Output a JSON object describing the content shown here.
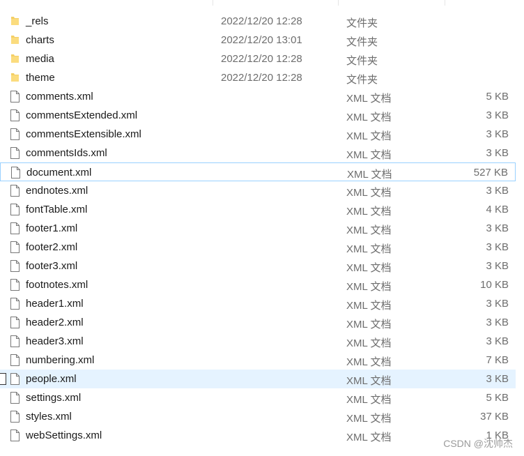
{
  "files": [
    {
      "name": "_rels",
      "date": "2022/12/20 12:28",
      "type": "文件夹",
      "size": "",
      "icon": "folder-icon"
    },
    {
      "name": "charts",
      "date": "2022/12/20 13:01",
      "type": "文件夹",
      "size": "",
      "icon": "folder-icon"
    },
    {
      "name": "media",
      "date": "2022/12/20 12:28",
      "type": "文件夹",
      "size": "",
      "icon": "folder-icon"
    },
    {
      "name": "theme",
      "date": "2022/12/20 12:28",
      "type": "文件夹",
      "size": "",
      "icon": "folder-icon"
    },
    {
      "name": "comments.xml",
      "date": "",
      "type": "XML 文档",
      "size": "5 KB",
      "icon": "file-icon"
    },
    {
      "name": "commentsExtended.xml",
      "date": "",
      "type": "XML 文档",
      "size": "3 KB",
      "icon": "file-icon"
    },
    {
      "name": "commentsExtensible.xml",
      "date": "",
      "type": "XML 文档",
      "size": "3 KB",
      "icon": "file-icon"
    },
    {
      "name": "commentsIds.xml",
      "date": "",
      "type": "XML 文档",
      "size": "3 KB",
      "icon": "file-icon"
    },
    {
      "name": "document.xml",
      "date": "",
      "type": "XML 文档",
      "size": "527 KB",
      "icon": "file-icon",
      "state": "focus"
    },
    {
      "name": "endnotes.xml",
      "date": "",
      "type": "XML 文档",
      "size": "3 KB",
      "icon": "file-icon"
    },
    {
      "name": "fontTable.xml",
      "date": "",
      "type": "XML 文档",
      "size": "4 KB",
      "icon": "file-icon"
    },
    {
      "name": "footer1.xml",
      "date": "",
      "type": "XML 文档",
      "size": "3 KB",
      "icon": "file-icon"
    },
    {
      "name": "footer2.xml",
      "date": "",
      "type": "XML 文档",
      "size": "3 KB",
      "icon": "file-icon"
    },
    {
      "name": "footer3.xml",
      "date": "",
      "type": "XML 文档",
      "size": "3 KB",
      "icon": "file-icon"
    },
    {
      "name": "footnotes.xml",
      "date": "",
      "type": "XML 文档",
      "size": "10 KB",
      "icon": "file-icon"
    },
    {
      "name": "header1.xml",
      "date": "",
      "type": "XML 文档",
      "size": "3 KB",
      "icon": "file-icon"
    },
    {
      "name": "header2.xml",
      "date": "",
      "type": "XML 文档",
      "size": "3 KB",
      "icon": "file-icon"
    },
    {
      "name": "header3.xml",
      "date": "",
      "type": "XML 文档",
      "size": "3 KB",
      "icon": "file-icon"
    },
    {
      "name": "numbering.xml",
      "date": "",
      "type": "XML 文档",
      "size": "7 KB",
      "icon": "file-icon"
    },
    {
      "name": "people.xml",
      "date": "",
      "type": "XML 文档",
      "size": "3 KB",
      "icon": "file-icon",
      "state": "hover"
    },
    {
      "name": "settings.xml",
      "date": "",
      "type": "XML 文档",
      "size": "5 KB",
      "icon": "file-icon"
    },
    {
      "name": "styles.xml",
      "date": "",
      "type": "XML 文档",
      "size": "37 KB",
      "icon": "file-icon"
    },
    {
      "name": "webSettings.xml",
      "date": "",
      "type": "XML 文档",
      "size": "1 KB",
      "icon": "file-icon"
    }
  ],
  "watermark": "CSDN @沈帅杰",
  "colors": {
    "focus_border": "#99d1ff",
    "hover_bg": "#e5f3ff",
    "folder": "#f4cf66"
  }
}
